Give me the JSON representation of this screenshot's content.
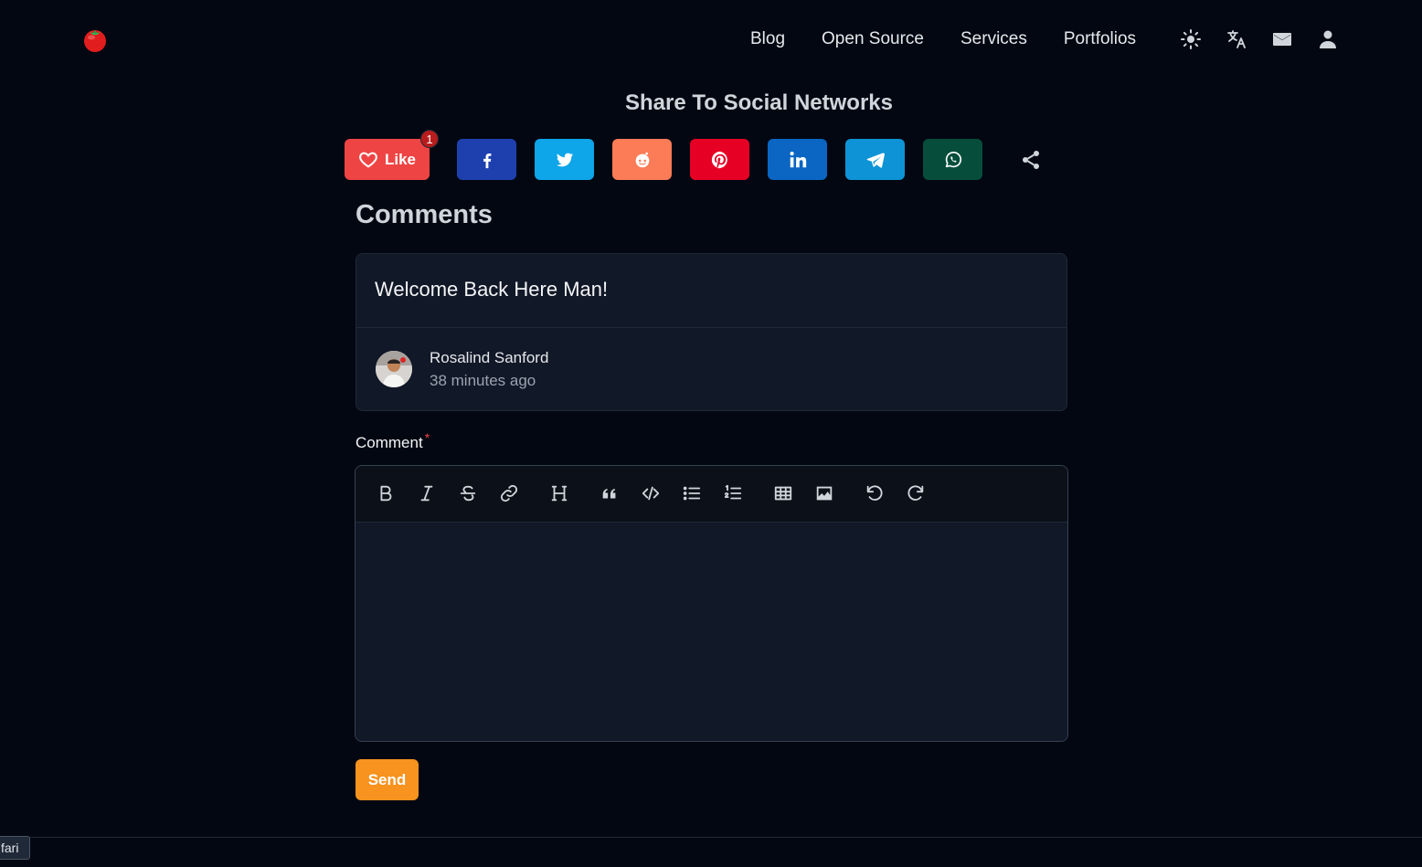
{
  "header": {
    "logo_icon": "tomato-icon",
    "nav": [
      "Blog",
      "Open Source",
      "Services",
      "Portfolios"
    ],
    "icons": [
      "sun-icon",
      "translate-icon",
      "mail-icon",
      "user-icon"
    ]
  },
  "share": {
    "title": "Share To Social Networks",
    "like_label": "Like",
    "like_count": "1",
    "buttons": [
      {
        "name": "facebook",
        "color": "#1e40af"
      },
      {
        "name": "twitter",
        "color": "#0ea5e9"
      },
      {
        "name": "reddit",
        "color": "#fb7c56"
      },
      {
        "name": "pinterest",
        "color": "#e60023"
      },
      {
        "name": "linkedin",
        "color": "#0a66c2"
      },
      {
        "name": "telegram",
        "color": "#0e94d6"
      },
      {
        "name": "whatsapp",
        "color": "#064e3b"
      }
    ]
  },
  "comments": {
    "title": "Comments",
    "items": [
      {
        "text": "Welcome Back Here Man!",
        "author": "Rosalind Sanford",
        "time": "38 minutes ago"
      }
    ]
  },
  "form": {
    "label": "Comment",
    "required_mark": "*",
    "toolbar": [
      "bold",
      "italic",
      "strikethrough",
      "link",
      "heading",
      "blockquote",
      "code",
      "bullet-list",
      "ordered-list",
      "table",
      "image",
      "undo",
      "redo"
    ],
    "send_label": "Send"
  },
  "tooltip": "fari",
  "colors": {
    "accent": "#f7931e",
    "like": "#ef4444",
    "background": "#030712"
  }
}
